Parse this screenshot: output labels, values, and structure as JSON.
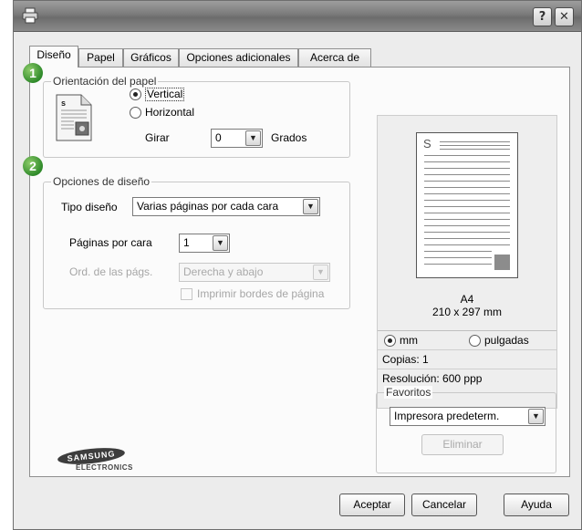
{
  "tabs": [
    "Diseño",
    "Papel",
    "Gráficos",
    "Opciones adicionales",
    "Acerca de"
  ],
  "orientation": {
    "group_label": "Orientación del papel",
    "vertical_label": "Vertical",
    "horizontal_label": "Horizontal",
    "selected": "Vertical",
    "rotate_label": "Girar",
    "rotate_value": "0",
    "rotate_unit": "Grados"
  },
  "layout": {
    "group_label": "Opciones de diseño",
    "type_label": "Tipo diseño",
    "type_value": "Varias páginas por cada cara",
    "pages_per_side_label": "Páginas por cara",
    "pages_per_side_value": "1",
    "page_order_label": "Ord. de las págs.",
    "page_order_value": "Derecha y abajo",
    "print_border_label": "Imprimir bordes de página"
  },
  "badges": [
    "1",
    "2"
  ],
  "preview": {
    "sheet_letter": "S",
    "paper_name": "A4",
    "paper_size": "210 x 297 mm",
    "unit_mm": "mm",
    "unit_inch": "pulgadas",
    "selected_unit": "mm",
    "copies": "Copias: 1",
    "resolution": "Resolución: 600 ppp"
  },
  "favorites": {
    "group_label": "Favoritos",
    "value": "Impresora predeterm.",
    "delete_label": "Eliminar"
  },
  "logo": {
    "brand": "SAMSUNG",
    "sub": "ELECTRONICS"
  },
  "buttons": {
    "ok": "Aceptar",
    "cancel": "Cancelar",
    "help": "Ayuda"
  },
  "titlebar": {
    "help_glyph": "?",
    "close_glyph": "✕"
  },
  "colors": {
    "badge_green": "#3a9a32",
    "titlebar": "#7a7a7a"
  }
}
